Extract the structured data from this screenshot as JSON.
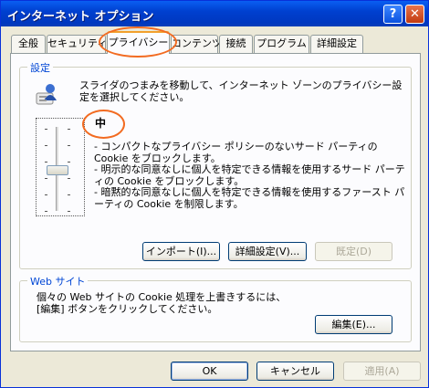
{
  "window": {
    "title": "インターネット オプション"
  },
  "tabs": [
    "全般",
    "セキュリティ",
    "プライバシー",
    "コンテンツ",
    "接続",
    "プログラム",
    "詳細設定"
  ],
  "settings": {
    "legend": "設定",
    "description": "スライダのつまみを移動して、インターネット ゾーンのプライバシー設定を選択してください。",
    "level": "中",
    "bullets": [
      "- コンパクトなプライバシー ポリシーのないサード パーティの Cookie をブロックします。",
      "- 明示的な同意なしに個人を特定できる情報を使用するサード パーティの Cookie をブロックします。",
      "- 暗黙的な同意なしに個人を特定できる情報を使用するファースト パーティの Cookie を制限します。"
    ],
    "import_label": "インポート(I)...",
    "advanced_label": "詳細設定(V)...",
    "default_label": "既定(D)"
  },
  "websites": {
    "legend": "Web サイト",
    "description_line1": "個々の Web サイトの Cookie 処理を上書きするには、",
    "description_line2": "[編集] ボタンをクリックしてください。",
    "edit_label": "編集(E)..."
  },
  "footer": {
    "ok_label": "OK",
    "cancel_label": "キャンセル",
    "apply_label": "適用(A)"
  },
  "colors": {
    "title_bar": "#0040d0",
    "highlight": "#f26b21",
    "legend_text": "#0046d5"
  },
  "slider": {
    "level_index": 2,
    "levels": 6
  }
}
